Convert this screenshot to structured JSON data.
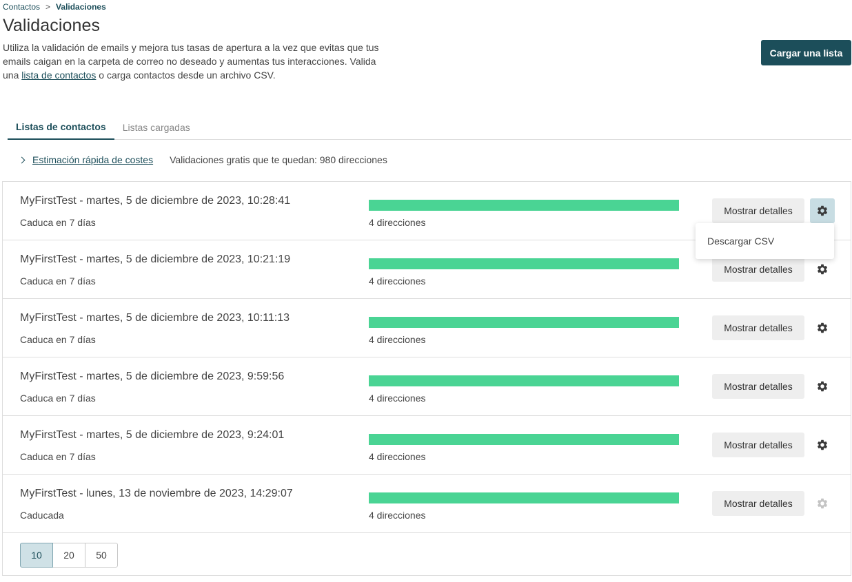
{
  "breadcrumb": {
    "parent": "Contactos",
    "separator": ">",
    "current": "Validaciones"
  },
  "page": {
    "title": "Validaciones",
    "intro_before": "Utiliza la validación de emails y mejora tus tasas de apertura a la vez que evitas que tus emails caigan en la carpeta de correo no deseado y aumentas tus interacciones. Valida una ",
    "intro_link": "lista de contactos",
    "intro_after": " o carga contactos desde un archivo CSV.",
    "upload_button": "Cargar una lista"
  },
  "tabs": [
    {
      "label": "Listas de contactos",
      "active": true
    },
    {
      "label": "Listas cargadas",
      "active": false
    }
  ],
  "estimate": {
    "link_label": "Estimación rápida de costes",
    "free_validations": "Validaciones gratis que te quedan: 980 direcciones"
  },
  "rows": [
    {
      "title": "MyFirstTest - martes, 5 de diciembre de 2023, 10:28:41",
      "status": "Caduca en 7 días",
      "addresses": "4 direcciones",
      "progress": 1.0,
      "details_label": "Mostrar detalles",
      "gear_enabled": true,
      "gear_active": true
    },
    {
      "title": "MyFirstTest - martes, 5 de diciembre de 2023, 10:21:19",
      "status": "Caduca en 7 días",
      "addresses": "4 direcciones",
      "progress": 1.0,
      "details_label": "Mostrar detalles",
      "gear_enabled": true,
      "gear_active": false
    },
    {
      "title": "MyFirstTest - martes, 5 de diciembre de 2023, 10:11:13",
      "status": "Caduca en 7 días",
      "addresses": "4 direcciones",
      "progress": 1.0,
      "details_label": "Mostrar detalles",
      "gear_enabled": true,
      "gear_active": false
    },
    {
      "title": "MyFirstTest - martes, 5 de diciembre de 2023, 9:59:56",
      "status": "Caduca en 7 días",
      "addresses": "4 direcciones",
      "progress": 1.0,
      "details_label": "Mostrar detalles",
      "gear_enabled": true,
      "gear_active": false
    },
    {
      "title": "MyFirstTest - martes, 5 de diciembre de 2023, 9:24:01",
      "status": "Caduca en 7 días",
      "addresses": "4 direcciones",
      "progress": 1.0,
      "details_label": "Mostrar detalles",
      "gear_enabled": true,
      "gear_active": false
    },
    {
      "title": "MyFirstTest - lunes, 13 de noviembre de 2023, 14:29:07",
      "status": "Caducada",
      "addresses": "4 direcciones",
      "progress": 1.0,
      "details_label": "Mostrar detalles",
      "gear_enabled": false,
      "gear_active": false
    }
  ],
  "gear_menu": {
    "item": "Descargar CSV"
  },
  "pagination": {
    "options": [
      "10",
      "20",
      "50"
    ],
    "selected": "10"
  },
  "icons": {
    "gear": "gear-icon",
    "chevron": "chevron-right-icon"
  },
  "colors": {
    "primary": "#1c4e5a",
    "progress": "#4ad494",
    "gear": "#3a3a3a",
    "gear_disabled": "#c4c4c4",
    "gear_active_bg": "#c8dde3"
  }
}
